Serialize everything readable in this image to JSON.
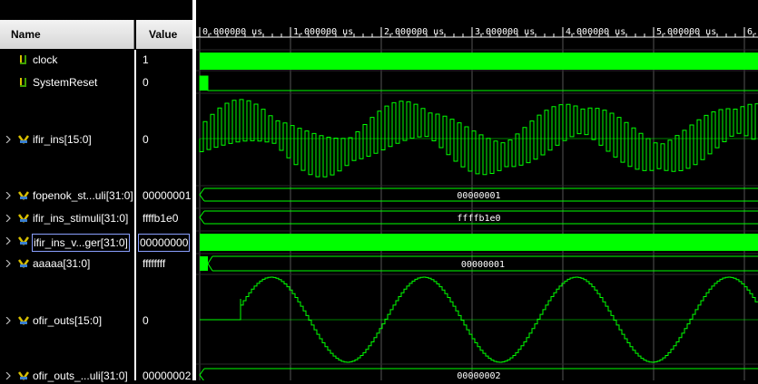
{
  "columns": {
    "name": "Name",
    "value": "Value"
  },
  "timeline": {
    "labels": [
      "0.000000 us",
      "1.000000 us",
      "2.000000 us",
      "3.000000 us",
      "4.000000 us",
      "5.000000 us",
      "6."
    ]
  },
  "signals": [
    {
      "name": "clock",
      "value": "1",
      "kind": "bit",
      "expandable": false
    },
    {
      "name": "SystemReset",
      "value": "0",
      "kind": "bit",
      "expandable": false
    },
    {
      "name": "ifir_ins[15:0]",
      "value": "0",
      "kind": "bus",
      "expandable": true
    },
    {
      "name": "fopenok_st...uli[31:0]",
      "value": "00000001",
      "kind": "bus",
      "expandable": true,
      "bus_label": "00000001"
    },
    {
      "name": "ifir_ins_stimuli[31:0]",
      "value": "ffffb1e0",
      "kind": "bus",
      "expandable": true,
      "bus_label": "ffffb1e0"
    },
    {
      "name": "ifir_ins_v...ger[31:0]",
      "value": "00000000",
      "kind": "bus",
      "expandable": true
    },
    {
      "name": "aaaaa[31:0]",
      "value": "ffffffff",
      "kind": "bus",
      "expandable": true,
      "bus_label": "00000001"
    },
    {
      "name": "ofir_outs[15:0]",
      "value": "0",
      "kind": "bus",
      "expandable": true
    },
    {
      "name": "ofir_outs_...uli[31:0]",
      "value": "00000002",
      "kind": "bus",
      "expandable": true,
      "bus_label": "00000002"
    }
  ],
  "colors": {
    "wave": "#00ff00",
    "grid": "#555555",
    "bg": "#000000",
    "divider": "#ffffff"
  },
  "icons": {
    "bit": "bit-signal-icon",
    "bus": "bus-signal-icon",
    "expander": "chevron-right-icon"
  }
}
